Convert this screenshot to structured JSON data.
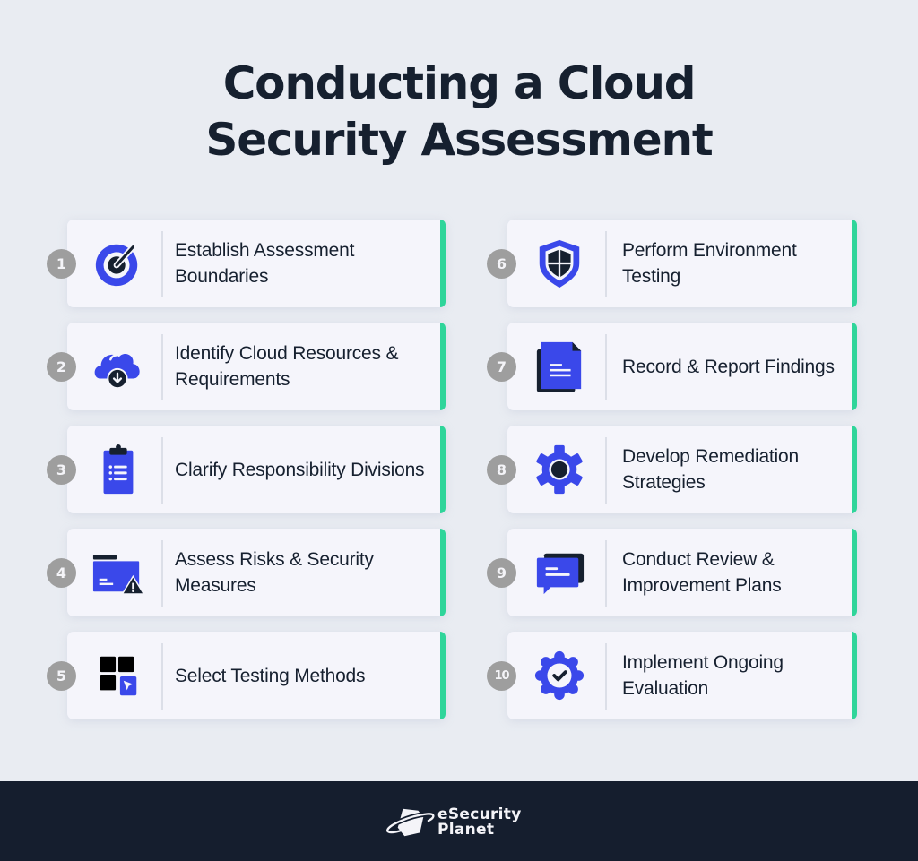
{
  "title": {
    "line1": "Conducting a Cloud",
    "line2": "Security Assessment"
  },
  "colors": {
    "accent_blue": "#3a48ea",
    "dark": "#16202f",
    "accent_green": "#2fd59a",
    "background": "#e9ecf2",
    "card": "#f5f5fb",
    "badge": "#9e9e9e",
    "footer": "#151e2e"
  },
  "steps": [
    {
      "number": "1",
      "icon": "target-icon",
      "label": "Establish Assessment Boundaries"
    },
    {
      "number": "2",
      "icon": "cloud-download-icon",
      "label": "Identify Cloud Resources & Requirements"
    },
    {
      "number": "3",
      "icon": "clipboard-list-icon",
      "label": "Clarify Responsibility Divisions"
    },
    {
      "number": "4",
      "icon": "folder-warning-icon",
      "label": "Assess Risks & Security Measures"
    },
    {
      "number": "5",
      "icon": "grid-cursor-icon",
      "label": "Select Testing Methods"
    },
    {
      "number": "6",
      "icon": "shield-icon",
      "label": "Perform Environment Testing"
    },
    {
      "number": "7",
      "icon": "documents-icon",
      "label": "Record & Report Findings"
    },
    {
      "number": "8",
      "icon": "gear-icon",
      "label": "Develop Remediation Strategies"
    },
    {
      "number": "9",
      "icon": "chat-bubbles-icon",
      "label": "Conduct Review & Improvement Plans"
    },
    {
      "number": "10",
      "icon": "verified-badge-icon",
      "label": "Implement Ongoing Evaluation"
    }
  ],
  "footer": {
    "logo_icon": "planet-logo-icon",
    "brand_line1": "eSecurity",
    "brand_line2": "Planet"
  }
}
